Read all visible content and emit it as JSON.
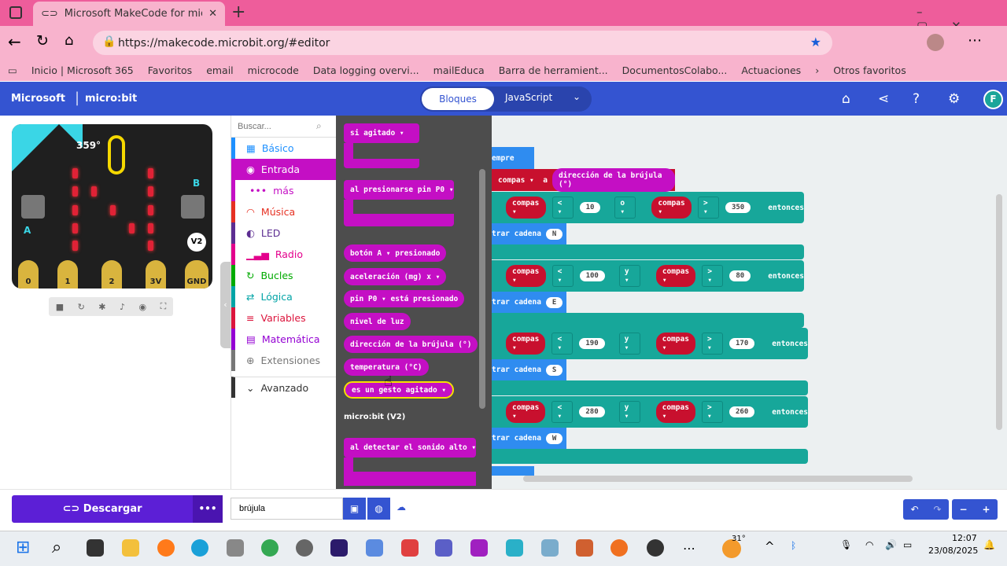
{
  "browser": {
    "tab_title": "Microsoft MakeCode for mic",
    "url": "https://makecode.microbit.org/#editor",
    "bookmarks": [
      "Inicio | Microsoft 365",
      "Favoritos",
      "email",
      "microcode",
      "Data logging overvi...",
      "mailEduca",
      "Barra de herramient...",
      "DocumentosColabo...",
      "Actuaciones"
    ],
    "other_favorites": "Otros favoritos"
  },
  "header": {
    "brand": "Microsoft",
    "product": "micro:bit",
    "blocks_label": "Bloques",
    "js_label": "JavaScript"
  },
  "simulator": {
    "heading": "359°",
    "version": "V2",
    "pins": [
      "0",
      "1",
      "2",
      "3V",
      "GND"
    ],
    "button_a": "A",
    "button_b": "B"
  },
  "toolbox": {
    "search_placeholder": "Buscar...",
    "items": [
      {
        "label": "Básico",
        "color": "#1e90ff",
        "icon": "grid-icon"
      },
      {
        "label": "Entrada",
        "color": "#c40fc4",
        "icon": "target-icon"
      },
      {
        "label": "más",
        "color": "#c40fc4",
        "icon": "dots-icon"
      },
      {
        "label": "Música",
        "color": "#e63022",
        "icon": "headphones-icon"
      },
      {
        "label": "LED",
        "color": "#5c2d91",
        "icon": "toggle-icon"
      },
      {
        "label": "Radio",
        "color": "#e3008c",
        "icon": "signal-icon"
      },
      {
        "label": "Bucles",
        "color": "#00aa00",
        "icon": "loop-icon"
      },
      {
        "label": "Lógica",
        "color": "#00a4a6",
        "icon": "logic-icon"
      },
      {
        "label": "Variables",
        "color": "#dc143c",
        "icon": "list-icon"
      },
      {
        "label": "Matemática",
        "color": "#9400d3",
        "icon": "calculator-icon"
      },
      {
        "label": "Extensiones",
        "color": "#777777",
        "icon": "plus-icon"
      },
      {
        "label": "Avanzado",
        "color": "#333333",
        "icon": "chevron-down-icon"
      }
    ]
  },
  "flyout": {
    "blocks": [
      "si agitado ▾",
      "al presionarse pin P0 ▾",
      "botón A ▾ presionado",
      "aceleración (mg) x ▾",
      "pin P0 ▾ está presionado",
      "nivel de luz",
      "dirección de la brújula (°)",
      "temperatura (°C)",
      "es un gesto agitado ▾",
      "al detectar el sonido alto ▾"
    ],
    "section": "micro:bit (V2)"
  },
  "workspace": {
    "forever": "empre",
    "set_var": "compas",
    "set_to": "a",
    "compass_block": "dirección de la brújula (°)",
    "ifs": [
      {
        "a": "10",
        "join": "o",
        "b": "350",
        "text": "N"
      },
      {
        "a": "100",
        "join": "y",
        "b": "80",
        "text": "E"
      },
      {
        "a": "190",
        "join": "y",
        "b": "170",
        "text": "S"
      },
      {
        "a": "280",
        "join": "y",
        "b": "260",
        "text": "W"
      }
    ],
    "var": "compas",
    "lt": "<",
    "gt": ">",
    "then": "entonces",
    "show_string": "trar cadena"
  },
  "bottom": {
    "download": "Descargar",
    "project_name": "brújula"
  },
  "taskbar": {
    "temp": "31°",
    "time": "12:07",
    "date": "23/08/2025"
  }
}
